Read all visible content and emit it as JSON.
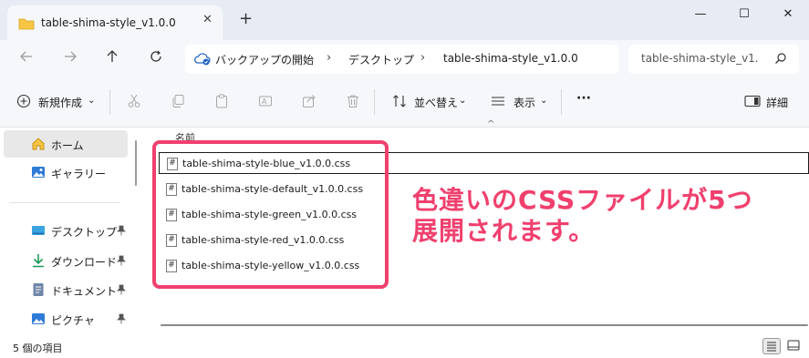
{
  "window": {
    "tab_title": "table-shima-style_v1.0.0",
    "tab_close": "✕",
    "new_tab": "+",
    "minimize": "—",
    "maximize": "☐",
    "close": "✕"
  },
  "address": {
    "crumbs": [
      "バックアップの開始",
      "デスクトップ",
      "table-shima-style_v1.0.0"
    ],
    "separator": "›",
    "search_placeholder": "table-shima-style_v1."
  },
  "toolbar": {
    "new_label": "新規作成",
    "sort_label": "並べ替え",
    "view_label": "表示",
    "more_label": "···",
    "details_label": "詳細",
    "dropdown": "⌄"
  },
  "sidebar": {
    "items": [
      {
        "label": "ホーム"
      },
      {
        "label": "ギャラリー"
      },
      {
        "label": "デスクトップ"
      },
      {
        "label": "ダウンロード"
      },
      {
        "label": "ドキュメント"
      },
      {
        "label": "ピクチャ"
      }
    ]
  },
  "list": {
    "column_name": "名前",
    "sort_caret": "^",
    "files": [
      "table-shima-style-blue_v1.0.0.css",
      "table-shima-style-default_v1.0.0.css",
      "table-shima-style-green_v1.0.0.css",
      "table-shima-style-red_v1.0.0.css",
      "table-shima-style-yellow_v1.0.0.css"
    ],
    "file_icon_glyph": "#"
  },
  "annotation": {
    "line1": "色違いのCSSファイルが5つ",
    "line2": "展開されます。",
    "color": "#f0406e"
  },
  "status": {
    "item_count": "5 個の項目"
  }
}
